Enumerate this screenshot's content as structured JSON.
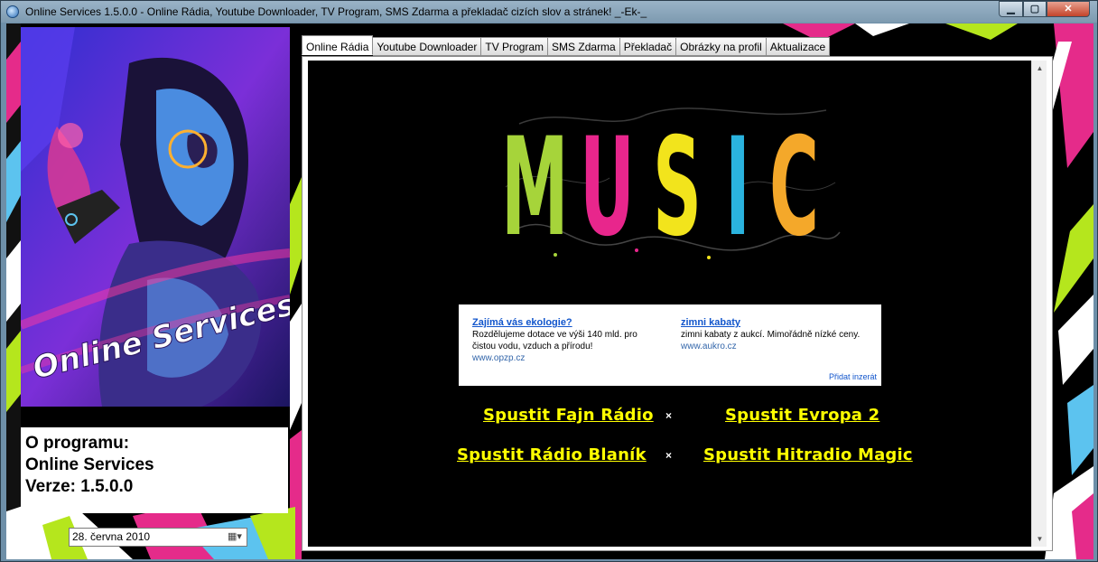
{
  "window": {
    "title": "Online Services 1.5.0.0 - Online Rádia, Youtube Downloader, TV Program,  SMS Zdarma a překladač cizích slov a stránek!   _-Ek-_",
    "min": "▁",
    "max": "▢",
    "close": "✕"
  },
  "left": {
    "logo_text": "Online Services",
    "info": {
      "line1": "O programu:",
      "line2": "Online Services",
      "line3": "Verze: 1.5.0.0"
    },
    "date": "28.  června   2010",
    "date_icon": "calendar-dropdown-icon"
  },
  "tabs": [
    "Online Rádia",
    "Youtube Downloader",
    "TV Program",
    "SMS Zdarma",
    "Překladač",
    "Obrázky na profil",
    "Aktualizace"
  ],
  "active_tab": 0,
  "music": {
    "letters": [
      "M",
      "U",
      "S",
      "I",
      "C"
    ],
    "colors": [
      "#a6d43a",
      "#e8268c",
      "#f2e41c",
      "#2ab3de",
      "#f4a82a"
    ]
  },
  "ad": {
    "left": {
      "title": "Zajímá vás ekologie?",
      "text": "Rozdělujeme dotace ve výši 140 mld. pro čistou vodu, vzduch a přírodu!",
      "url": "www.opzp.cz"
    },
    "right": {
      "title": "zimni kabaty",
      "text": "zimni kabaty z aukcí. Mimořádně nízké ceny.",
      "url": "www.aukro.cz"
    },
    "add_link": "Přidat inzerát"
  },
  "radios": {
    "r1": "Spustit Fajn Rádio",
    "r2": "Spustit Evropa 2",
    "r3": "Spustit Rádio Blaník ",
    "r4": "Spustit Hitradio Magic",
    "sep": "×"
  }
}
